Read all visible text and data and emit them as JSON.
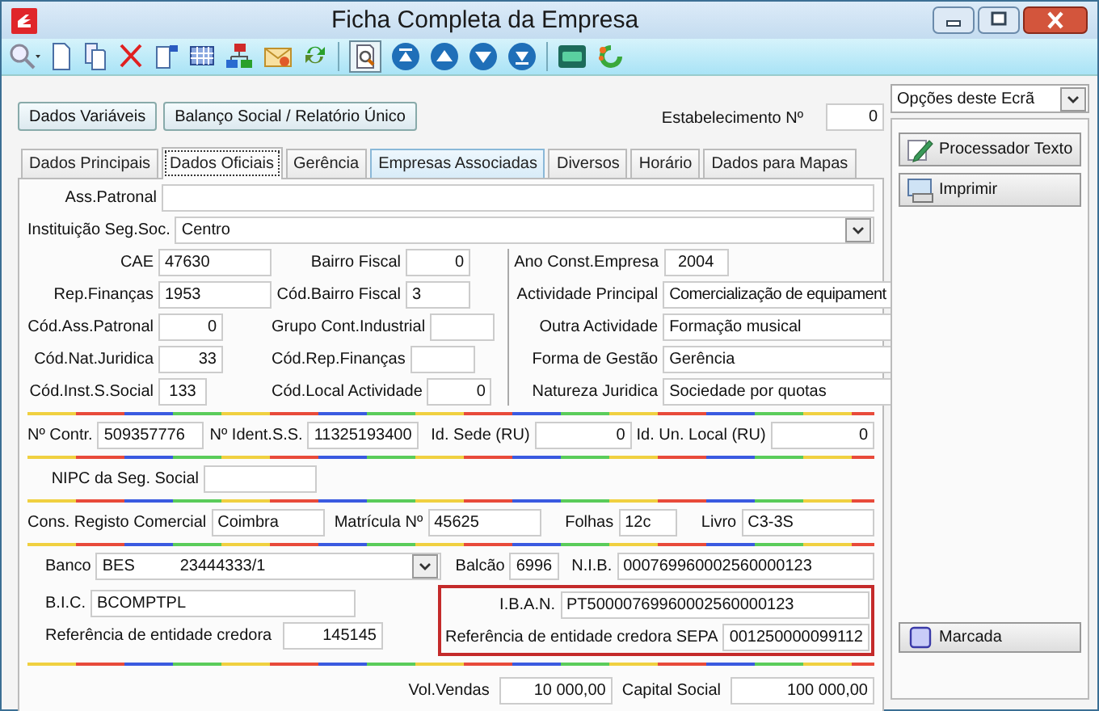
{
  "window": {
    "title": "Ficha Completa da Empresa"
  },
  "top_buttons": [
    {
      "label": "Dados Variáveis"
    },
    {
      "label": "Balanço Social / Relatório Único"
    }
  ],
  "establishment": {
    "label": "Estabelecimento Nº",
    "value": "0"
  },
  "tabs": [
    {
      "label": "Dados Principais",
      "selected": false,
      "hovered": false
    },
    {
      "label": "Dados Oficiais",
      "selected": true,
      "hovered": false
    },
    {
      "label": "Gerência",
      "selected": false,
      "hovered": false
    },
    {
      "label": "Empresas Associadas",
      "selected": false,
      "hovered": true
    },
    {
      "label": "Diversos",
      "selected": false,
      "hovered": false
    },
    {
      "label": "Horário",
      "selected": false,
      "hovered": false
    },
    {
      "label": "Dados para Mapas",
      "selected": false,
      "hovered": false
    }
  ],
  "ass_patronal": {
    "label": "Ass.Patronal"
  },
  "social_security_institution": {
    "label": "Instituição Seg.Soc.",
    "value": "Centro"
  },
  "codes_column_1": [
    {
      "label": "CAE",
      "value": "47630"
    },
    {
      "label": "Rep.Finanças",
      "value": "1953"
    },
    {
      "label": "Cód.Ass.Patronal",
      "value": "0"
    },
    {
      "label": "Cód.Nat.Juridica",
      "value": "33"
    },
    {
      "label": "Cód.Inst.S.Social",
      "value": "133"
    }
  ],
  "codes_column_2": [
    {
      "label": "Bairro Fiscal",
      "value": "0"
    },
    {
      "label": "Cód.Bairro Fiscal",
      "value": "3"
    },
    {
      "label": "Grupo Cont.Industrial"
    },
    {
      "label": "Cód.Rep.Finanças"
    },
    {
      "label": "Cód.Local Actividade",
      "value": "0"
    }
  ],
  "codes_column_3": [
    {
      "label": "Ano Const.Empresa",
      "value": "2004"
    },
    {
      "label": "Actividade Principal",
      "value": "Comercialização de equipament"
    },
    {
      "label": "Outra Actividade",
      "value": "Formação musical"
    },
    {
      "label": "Forma de Gestão",
      "value": "Gerência"
    },
    {
      "label": "Natureza Juridica",
      "value": "Sociedade por quotas"
    }
  ],
  "ids": [
    {
      "label": "Nº Contr.",
      "value": "509357776"
    },
    {
      "label": "Nº Ident.S.S.",
      "value": "11325193400"
    },
    {
      "label": "Id. Sede (RU)",
      "value": "0"
    },
    {
      "label": "Id. Un. Local (RU)",
      "value": "0"
    }
  ],
  "nipc": {
    "label": "NIPC da Seg. Social"
  },
  "registry": [
    {
      "label": "Cons. Registo Comercial",
      "value": "Coimbra"
    },
    {
      "label": "Matrícula Nº",
      "value": "45625"
    },
    {
      "label": "Folhas",
      "value": "12c"
    },
    {
      "label": "Livro",
      "value": "C3-3S"
    }
  ],
  "bank": {
    "label": "Banco",
    "bank": "BES",
    "account": "23444333/1"
  },
  "branch": {
    "label": "Balcão",
    "value": "6996"
  },
  "nib": {
    "label": "N.I.B.",
    "value": "000769960002560000123"
  },
  "bic": {
    "label": "B.I.C.",
    "value": "BCOMPTPL"
  },
  "creditor_reference": {
    "label": "Referência de entidade credora",
    "value": "145145"
  },
  "iban": {
    "label": "I.B.A.N.",
    "value": "PT50000769960002560000123"
  },
  "sepa_reference": {
    "label": "Referência de entidade credora SEPA",
    "value": "001250000099112"
  },
  "sales": {
    "label": "Vol.Vendas",
    "value": "10 000,00"
  },
  "capital": {
    "label": "Capital Social",
    "value": "100 000,00"
  },
  "options_menu": {
    "label": "Opções deste Ecrã"
  },
  "side_buttons": [
    {
      "label": "Processador Texto",
      "kind": "editor"
    },
    {
      "label": "Imprimir",
      "kind": "print"
    },
    {
      "label": "Marcada",
      "kind": "mark"
    }
  ]
}
